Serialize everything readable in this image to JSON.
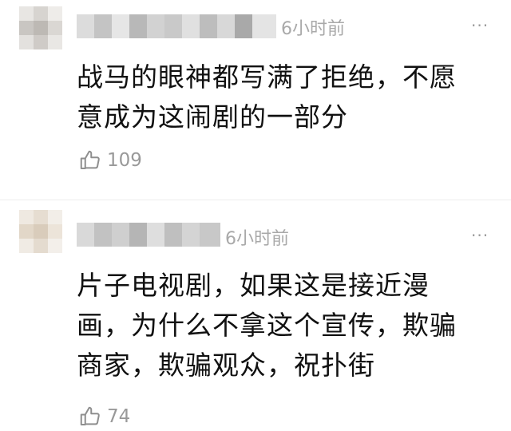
{
  "comments": [
    {
      "time": "6小时前",
      "more": "···",
      "lines": [
        "战马的眼神都写满了拒绝，不愿",
        "意成为这闹剧的一部分"
      ],
      "likes": "109",
      "like_icon": "thumbs-up-icon"
    },
    {
      "time": "6小时前",
      "more": "···",
      "lines": [
        "片子电视剧，如果这是接近漫",
        "画，为什么不拿这个宣传，欺骗",
        "商家，欺骗观众，祝扑街"
      ],
      "likes": "74",
      "like_icon": "thumbs-up-icon"
    }
  ],
  "colors": {
    "text": "#111111",
    "meta": "#a9a9a9",
    "divider": "#ececec"
  }
}
